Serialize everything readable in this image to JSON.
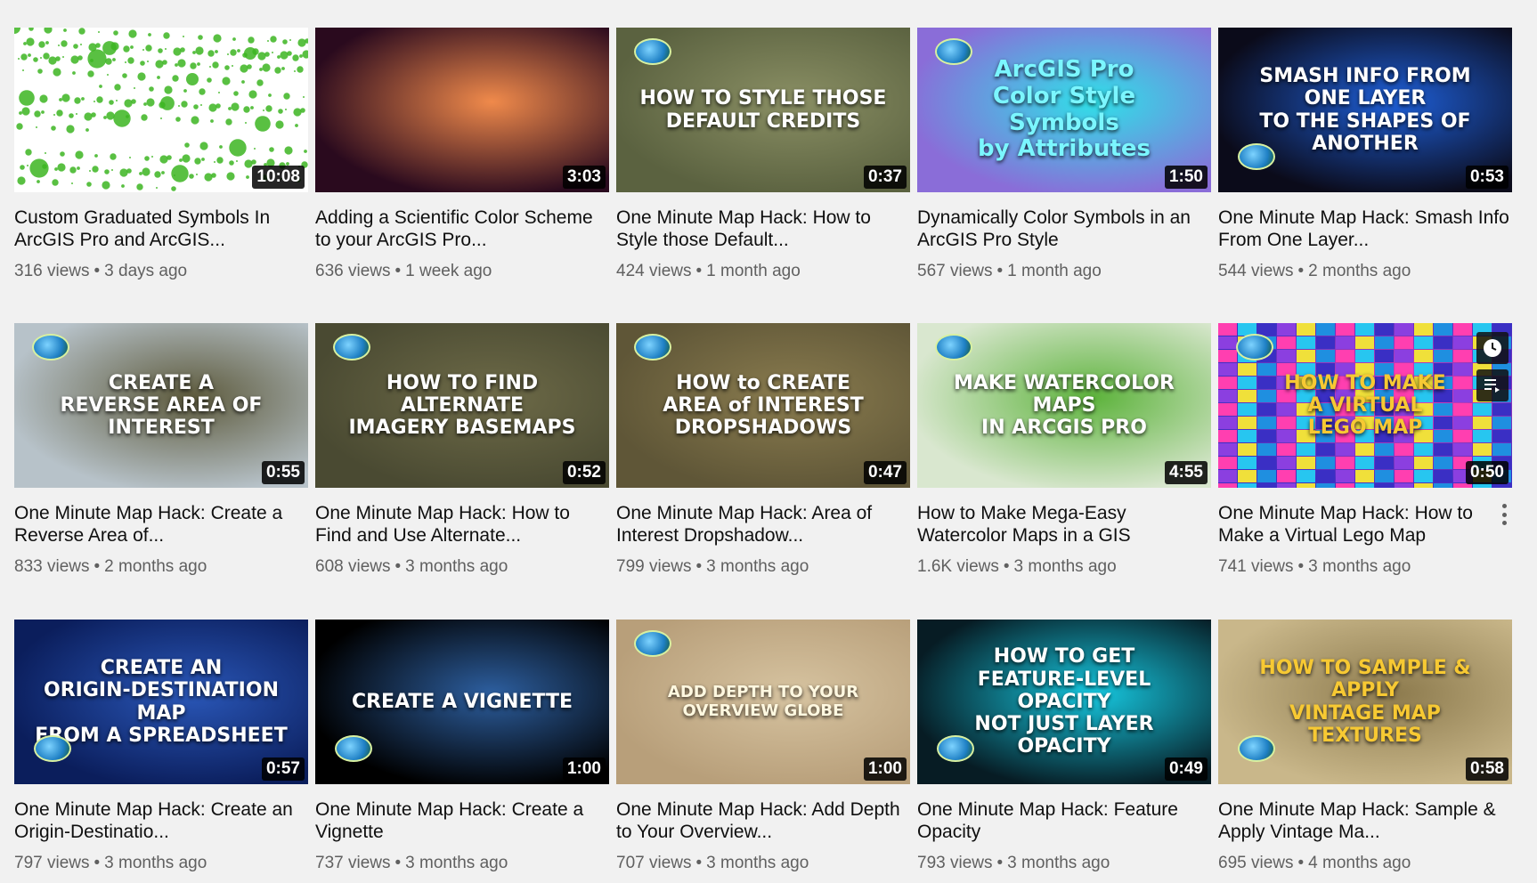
{
  "videos": [
    {
      "title": "Custom Graduated Symbols In ArcGIS Pro and ArcGIS...",
      "views": "316 views",
      "age": "3 days ago",
      "duration": "10:08",
      "thumb_text": "",
      "bg": "#ffffff",
      "accent": "#3cb521"
    },
    {
      "title": "Adding a Scientific Color Scheme to your ArcGIS Pro...",
      "views": "636 views",
      "age": "1 week ago",
      "duration": "3:03",
      "thumb_text": "",
      "bg": "#2a0a1e",
      "accent": "#f08a4b"
    },
    {
      "title": "One Minute Map Hack: How to Style those Default...",
      "views": "424 views",
      "age": "1 month ago",
      "duration": "0:37",
      "thumb_text": "HOW TO STYLE THOSE\nDEFAULT CREDITS",
      "bg": "#5b6240",
      "accent": "#8a8f64"
    },
    {
      "title": "Dynamically Color Symbols in an ArcGIS Pro Style",
      "views": "567 views",
      "age": "1 month ago",
      "duration": "1:50",
      "thumb_text": "ArcGIS Pro\nColor Style\nSymbols\nby Attributes",
      "bg": "#8a6dd8",
      "accent": "#2fe0e8"
    },
    {
      "title": "One Minute Map Hack: Smash Info From One Layer...",
      "views": "544 views",
      "age": "2 months ago",
      "duration": "0:53",
      "thumb_text": "SMASH INFO FROM ONE LAYER\nTO THE SHAPES OF ANOTHER",
      "bg": "#0b0b1a",
      "accent": "#1e5fd8"
    },
    {
      "title": "One Minute Map Hack: Create a Reverse Area of...",
      "views": "833 views",
      "age": "2 months ago",
      "duration": "0:55",
      "thumb_text": "CREATE A\nREVERSE AREA OF INTEREST",
      "bg": "#b7c2c9",
      "accent": "#5d5a3c"
    },
    {
      "title": "One Minute Map Hack: How to Find and Use Alternate...",
      "views": "608 views",
      "age": "3 months ago",
      "duration": "0:52",
      "thumb_text": "HOW TO FIND      ALTERNATE\nIMAGERY BASEMAPS",
      "bg": "#4a4a32",
      "accent": "#6e6b48"
    },
    {
      "title": "One Minute Map Hack: Area of Interest Dropshadow...",
      "views": "799 views",
      "age": "3 months ago",
      "duration": "0:47",
      "thumb_text": "HOW to CREATE\nAREA of INTEREST\nDROPSHADOWS",
      "bg": "#5f5637",
      "accent": "#8a7c4f"
    },
    {
      "title": "How to Make Mega-Easy Watercolor Maps in a GIS",
      "views": "1.6K views",
      "age": "3 months ago",
      "duration": "4:55",
      "thumb_text": "MAKE WATERCOLOR MAPS\nIN ARCGIS PRO",
      "bg": "#d9e7cf",
      "accent": "#5db33c"
    },
    {
      "title": "One Minute Map Hack: How to Make a Virtual Lego Map",
      "views": "741 views",
      "age": "3 months ago",
      "duration": "0:50",
      "thumb_text": "HOW TO MAKE\nA VIRTUAL\nLEGO MAP",
      "bg": "#3a2fc4",
      "accent": "#ff3fb0"
    },
    {
      "title": "One Minute Map Hack: Create an Origin-Destinatio...",
      "views": "797 views",
      "age": "3 months ago",
      "duration": "0:57",
      "thumb_text": "CREATE AN\nORIGIN-DESTINATION MAP\nFROM A SPREADSHEET",
      "bg": "#0b1e5c",
      "accent": "#2a57b8"
    },
    {
      "title": "One Minute Map Hack: Create a Vignette",
      "views": "737 views",
      "age": "3 months ago",
      "duration": "1:00",
      "thumb_text": "CREATE A VIGNETTE",
      "bg": "#000000",
      "accent": "#2d5fa0"
    },
    {
      "title": "One Minute Map Hack: Add Depth to Your Overview...",
      "views": "707 views",
      "age": "3 months ago",
      "duration": "1:00",
      "thumb_text": "ADD DEPTH TO YOUR\nOVERVIEW GLOBE",
      "bg": "#b89f7a",
      "accent": "#d6c3a0"
    },
    {
      "title": "One Minute Map Hack: Feature Opacity",
      "views": "793 views",
      "age": "3 months ago",
      "duration": "0:49",
      "thumb_text": "HOW TO GET\nFEATURE-LEVEL OPACITY\nNOT JUST LAYER OPACITY",
      "bg": "#071c24",
      "accent": "#16c8e0"
    },
    {
      "title": "One Minute Map Hack: Sample & Apply Vintage Ma...",
      "views": "695 views",
      "age": "4 months ago",
      "duration": "0:58",
      "thumb_text": "HOW TO SAMPLE & APPLY\nVINTAGE MAP TEXTURES",
      "bg": "#c9b78a",
      "accent": "#8d7b4e"
    }
  ],
  "hover_actions": {
    "watch_later_icon": "clock-icon",
    "add_to_queue_icon": "queue-icon",
    "menu_icon": "more-vert-icon"
  },
  "separator": "•"
}
